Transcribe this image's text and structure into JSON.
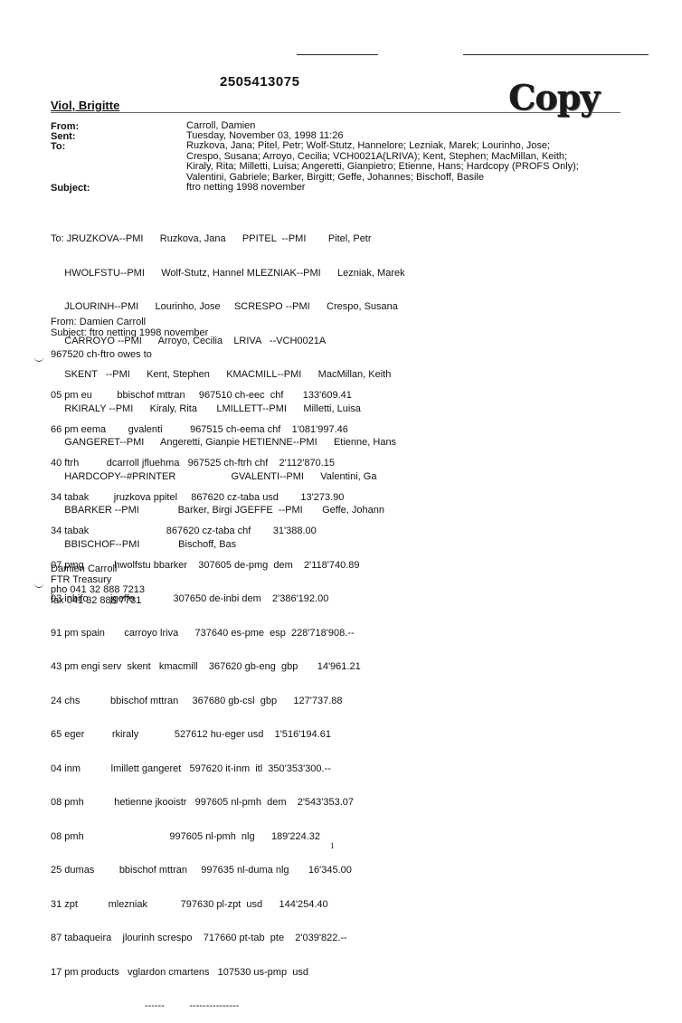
{
  "doc_number": "2505413075",
  "author": "Viol, Brigitte",
  "stamp": "Copy",
  "header": {
    "from_label": "From:",
    "from_value": "Carroll, Damien",
    "sent_label": "Sent:",
    "sent_value": "Tuesday, November 03, 1998 11:26",
    "to_label": "To:",
    "to_value_lines": [
      "Ruzkova, Jana; Pitel, Petr; Wolf-Stutz, Hannelore; Lezniak, Marek; Lourinho, Jose;",
      "Crespo, Susana; Arroyo, Cecilia; VCH0021A(LRIVA); Kent, Stephen; MacMillan, Keith;",
      "Kiraly, Rita; Milletti, Luisa; Angeretti, Gianpietro; Etienne, Hans; Hardcopy (PROFS Only);",
      "Valentini, Gabriele; Barker, Birgitt; Geffe, Johannes; Bischoff, Basile"
    ],
    "subject_label": "Subject:",
    "subject_value": "ftro netting 1998 november"
  },
  "to_list": [
    "To: JRUZKOVA--PMI      Ruzkova, Jana      PPITEL  --PMI        Pitel, Petr",
    "     HWOLFSTU--PMI      Wolf-Stutz, Hannel MLEZNIAK--PMI      Lezniak, Marek",
    "     JLOURINH--PMI      Lourinho, Jose     SCRESPO --PMI      Crespo, Susana",
    "     CARROYO --PMI      Arroyo, Cecilia    LRIVA   --VCH0021A",
    "     SKENT   --PMI      Kent, Stephen      KMACMILL--PMI      MacMillan, Keith",
    "     RKIRALY --PMI      Kiraly, Rita       LMILLETT--PMI      Milletti, Luisa",
    "     GANGERET--PMI      Angeretti, Gianpie HETIENNE--PMI      Etienne, Hans",
    "     HARDCOPY--#PRINTER                    GVALENTI--PMI      Valentini, Ga",
    "     BBARKER --PMI              Barker, Birgi JGEFFE  --PMI       Geffe, Johann",
    "     BBISCHOF--PMI              Bischoff, Bas"
  ],
  "from_block": {
    "from": "From: Damien Carroll",
    "subject": "Subject: ftro netting 1998 november"
  },
  "owes_line": "967520 ch-ftro owes to",
  "rows": [
    "05 pm eu         bbischof mttran     967510 ch-eec  chf       133'609.41",
    "66 pm eema        gvalenti          967515 ch-eema chf    1'081'997.46",
    "40 ftrh          dcarroll jfluehma   967525 ch-ftrh chf    2'112'870.15",
    "34 tabak         jruzkova ppitel     867620 cz-taba usd        13'273.90",
    "34 tabak                            867620 cz-taba chf        31'388.00",
    "07 pmg           hwolfstu bbarker    307605 de-pmg  dem    2'118'740.89",
    "03 inbifo        jgeffe              307650 de-inbi dem    2'386'192.00",
    "91 pm spain       carroyo lriva      737640 es-pme  esp  228'718'908.--",
    "43 pm engi serv  skent   kmacmill    367620 gb-eng  gbp       14'961.21",
    "24 chs           bbischof mttran     367680 gb-csl  gbp      127'737.88",
    "65 eger          rkiraly             527612 hu-eger usd    1'516'194.61",
    "04 inm           lmillett gangeret   597620 it-inm  itl  350'353'300.--",
    "08 pmh           hetienne jkooistr   997605 nl-pmh  dem    2'543'353.07",
    "08 pmh                               997605 nl-pmh  nlg      189'224.32",
    "25 dumas         bbischof mttran     997635 nl-duma nlg       16'345.00",
    "31 zpt           mlezniak            797630 pl-zpt  usd      144'254.40",
    "87 tabaqueira    jlourinh screspo    717660 pt-tab  pte    2'039'822.--",
    "17 pm products   vglardon cmartens   107530 us-pmp  usd",
    "                                  ------         ---------------"
  ],
  "signature": [
    "Damien Carroll",
    "FTR Treasury",
    "pho 041 32 888 7213",
    "fax 041 32 888 7731"
  ],
  "page_number": "1"
}
